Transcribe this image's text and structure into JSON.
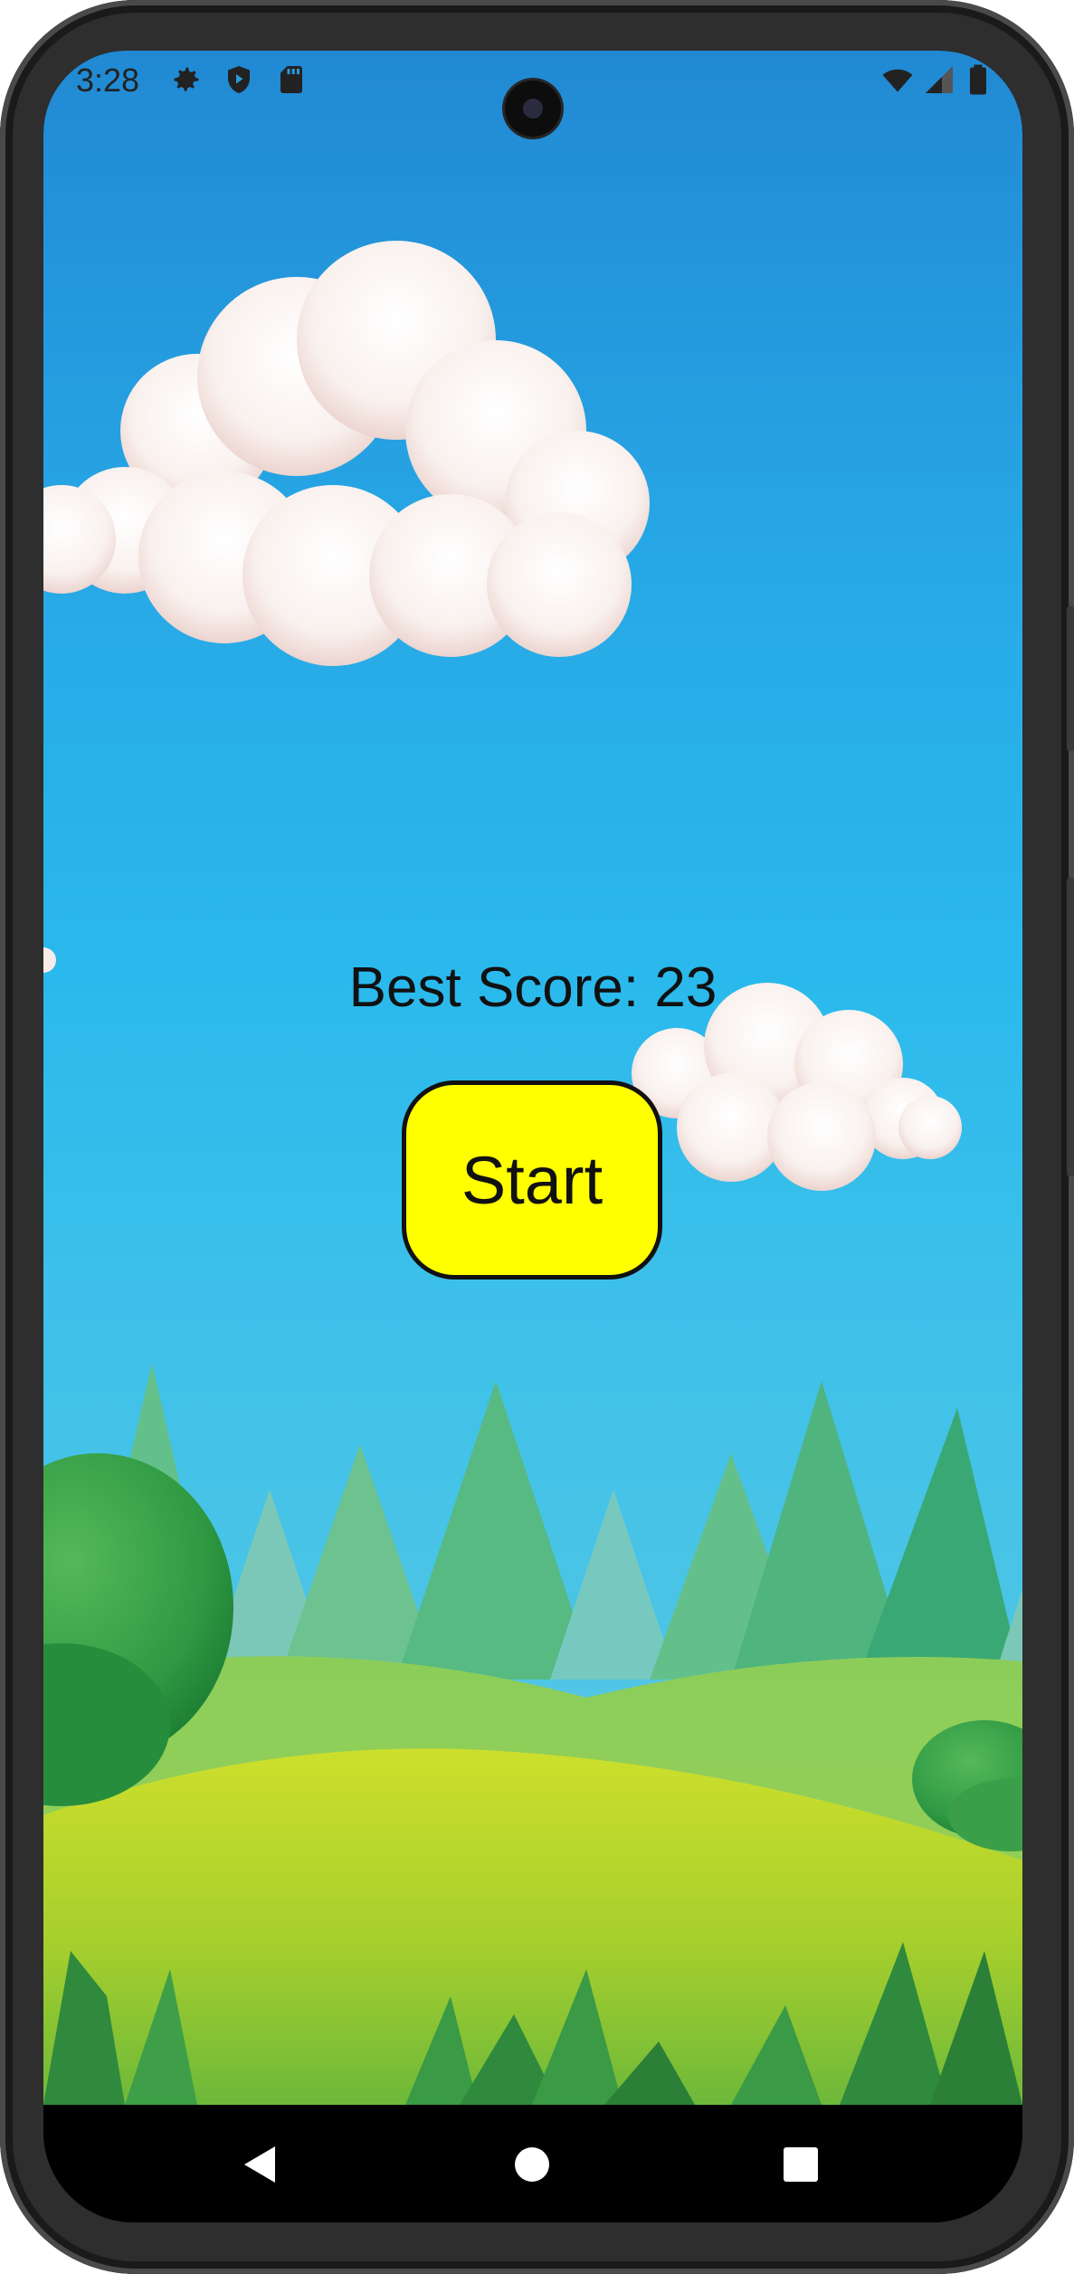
{
  "status_bar": {
    "time": "3:28",
    "left_icons": [
      "settings-icon",
      "shield-play-icon",
      "sd-card-icon"
    ],
    "right_icons": [
      "wifi-icon",
      "cell-signal-icon",
      "battery-icon"
    ]
  },
  "game": {
    "best_score_text": "Best Score: 23",
    "start_label": "Start",
    "start_color": "#ffff00"
  },
  "nav_bar": {
    "buttons": [
      "back-icon",
      "home-icon",
      "recents-icon"
    ]
  }
}
